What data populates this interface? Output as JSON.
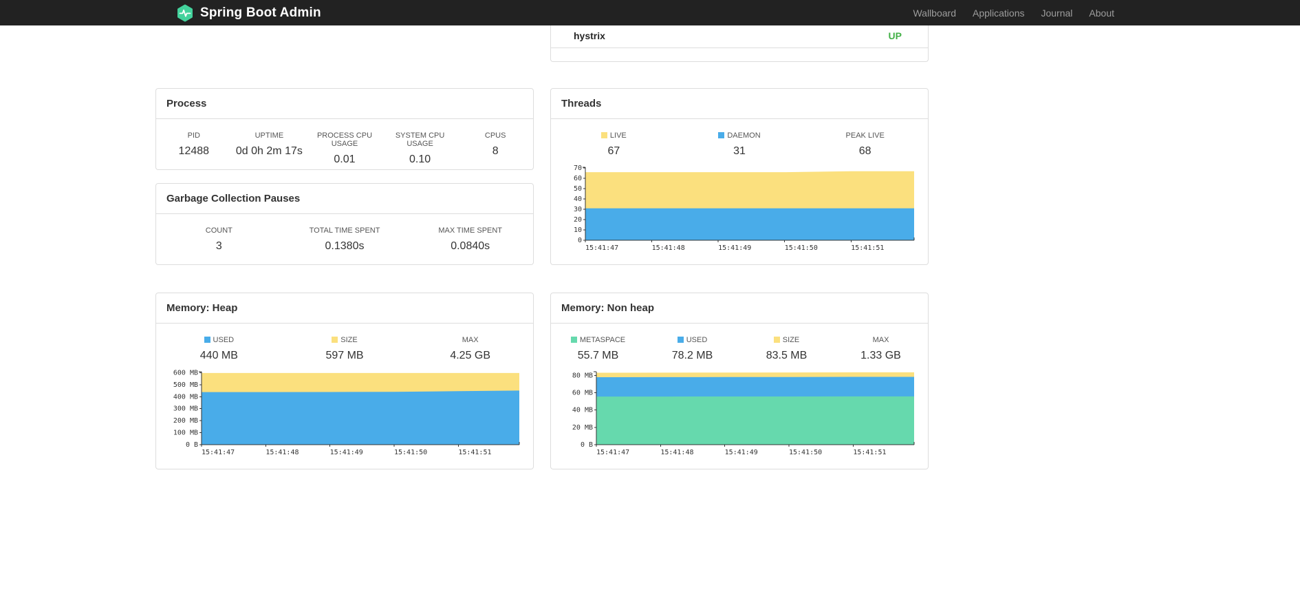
{
  "navbar": {
    "brand": "Spring Boot Admin",
    "logo_color": "#43d29c",
    "links": [
      {
        "label": "Wallboard"
      },
      {
        "label": "Applications"
      },
      {
        "label": "Journal"
      },
      {
        "label": "About"
      }
    ]
  },
  "application_status": {
    "name": "hystrix",
    "status": "UP",
    "status_color": "#43b047"
  },
  "panels": {
    "process": {
      "title": "Process",
      "stats": [
        {
          "label": "PID",
          "value": "12488"
        },
        {
          "label": "UPTIME",
          "value": "0d 0h 2m 17s"
        },
        {
          "label": "PROCESS CPU USAGE",
          "value": "0.01"
        },
        {
          "label": "SYSTEM CPU USAGE",
          "value": "0.10"
        },
        {
          "label": "CPUS",
          "value": "8"
        }
      ]
    },
    "gc": {
      "title": "Garbage Collection Pauses",
      "stats": [
        {
          "label": "COUNT",
          "value": "3"
        },
        {
          "label": "TOTAL TIME SPENT",
          "value": "0.1380s"
        },
        {
          "label": "MAX TIME SPENT",
          "value": "0.0840s"
        }
      ]
    },
    "threads": {
      "title": "Threads",
      "stats": [
        {
          "label": "LIVE",
          "value": "67",
          "swatch": "#FBE07E"
        },
        {
          "label": "DAEMON",
          "value": "31",
          "swatch": "#49ACE9"
        },
        {
          "label": "PEAK LIVE",
          "value": "68"
        }
      ]
    },
    "heap": {
      "title": "Memory: Heap",
      "stats": [
        {
          "label": "USED",
          "value": "440 MB",
          "swatch": "#49ACE9"
        },
        {
          "label": "SIZE",
          "value": "597 MB",
          "swatch": "#FBE07E"
        },
        {
          "label": "MAX",
          "value": "4.25 GB"
        }
      ]
    },
    "nonheap": {
      "title": "Memory: Non heap",
      "stats": [
        {
          "label": "METASPACE",
          "value": "55.7 MB",
          "swatch": "#66D9AD"
        },
        {
          "label": "USED",
          "value": "78.2 MB",
          "swatch": "#49ACE9"
        },
        {
          "label": "SIZE",
          "value": "83.5 MB",
          "swatch": "#FBE07E"
        },
        {
          "label": "MAX",
          "value": "1.33 GB"
        }
      ]
    }
  },
  "chart_data": [
    {
      "id": "threads",
      "type": "area",
      "title": "Threads",
      "x_labels": [
        "15:41:47",
        "15:41:48",
        "15:41:49",
        "15:41:50",
        "15:41:51"
      ],
      "x": [
        0,
        1,
        2,
        3,
        4,
        4.95
      ],
      "x_domain": [
        0,
        4.95
      ],
      "y_ticks": [
        0,
        10,
        20,
        30,
        40,
        50,
        60,
        70
      ],
      "y_tick_labels": [
        "0",
        "10",
        "20",
        "30",
        "40",
        "50",
        "60",
        "70"
      ],
      "y_domain": [
        0,
        70.8
      ],
      "grid": false,
      "legend_position": "top",
      "series": [
        {
          "name": "LIVE",
          "color": "#FBE07E",
          "values": [
            66,
            66,
            66,
            66,
            67,
            67
          ]
        },
        {
          "name": "DAEMON",
          "color": "#49ACE9",
          "values": [
            31,
            31,
            31,
            31,
            31,
            31
          ]
        }
      ]
    },
    {
      "id": "heap",
      "type": "area",
      "title": "Memory: Heap",
      "x_labels": [
        "15:41:47",
        "15:41:48",
        "15:41:49",
        "15:41:50",
        "15:41:51"
      ],
      "x": [
        0,
        1,
        2,
        3,
        4,
        4.95
      ],
      "x_domain": [
        0,
        4.95
      ],
      "y_ticks": [
        0,
        100,
        200,
        300,
        400,
        500,
        600
      ],
      "y_tick_labels": [
        "0 B",
        "100 MB",
        "200 MB",
        "300 MB",
        "400 MB",
        "500 MB",
        "600 MB"
      ],
      "y_domain": [
        0,
        608
      ],
      "grid": false,
      "legend_position": "top",
      "series": [
        {
          "name": "SIZE",
          "color": "#FBE07E",
          "values": [
            597,
            597,
            597,
            597,
            597,
            597
          ]
        },
        {
          "name": "USED",
          "color": "#49ACE9",
          "values": [
            438,
            438,
            439,
            440,
            446,
            451
          ]
        }
      ]
    },
    {
      "id": "nonheap",
      "type": "area",
      "title": "Memory: Non heap",
      "x_labels": [
        "15:41:47",
        "15:41:48",
        "15:41:49",
        "15:41:50",
        "15:41:51"
      ],
      "x": [
        0,
        1,
        2,
        3,
        4,
        4.95
      ],
      "x_domain": [
        0,
        4.95
      ],
      "y_ticks": [
        0,
        20,
        40,
        60,
        80
      ],
      "y_tick_labels": [
        "0 B",
        "20 MB",
        "40 MB",
        "60 MB",
        "80 MB"
      ],
      "y_domain": [
        0,
        84.2
      ],
      "grid": false,
      "legend_position": "top",
      "series": [
        {
          "name": "SIZE",
          "color": "#FBE07E",
          "values": [
            83,
            83.1,
            83.2,
            83.3,
            83.5,
            83.5
          ]
        },
        {
          "name": "USED",
          "color": "#49ACE9",
          "values": [
            77.8,
            77.9,
            78,
            78,
            78.2,
            78.2
          ]
        },
        {
          "name": "METASPACE",
          "color": "#66D9AD",
          "values": [
            55.5,
            55.5,
            55.6,
            55.6,
            55.7,
            55.7
          ]
        }
      ]
    }
  ]
}
